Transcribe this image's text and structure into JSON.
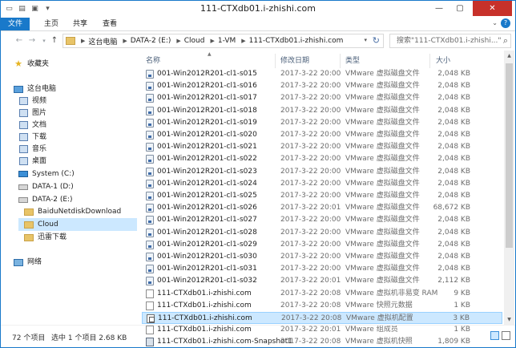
{
  "window": {
    "title": "111-CTXdb01.i-zhishi.com",
    "minimize_glyph": "—",
    "maximize_glyph": "▢",
    "close_glyph": "✕"
  },
  "quick_access": [
    "folder-icon",
    "properties-icon",
    "new-folder-icon",
    "customize-dropdown-icon"
  ],
  "ribbon": {
    "tabs": [
      "文件",
      "主页",
      "共享",
      "查看"
    ],
    "expand_glyph": "⌄",
    "help_glyph": "?"
  },
  "address": {
    "breadcrumbs": [
      "这台电脑",
      "DATA-2 (E:)",
      "Cloud",
      "1-VM",
      "111-CTXdb01.i-zhishi.com"
    ],
    "search_placeholder": "搜索\"111-CTXdb01.i-zhishi...\""
  },
  "nav": {
    "favorites": "收藏夹",
    "this_pc": "这台电脑",
    "videos": "视频",
    "pictures": "图片",
    "documents": "文档",
    "downloads": "下载",
    "music": "音乐",
    "desktop": "桌面",
    "system_c": "System (C:)",
    "data1_d": "DATA-1 (D:)",
    "data2_e": "DATA-2 (E:)",
    "baidu": "BaiduNetdiskDownload",
    "cloud": "Cloud",
    "xunlei": "迅雷下载",
    "network": "网络"
  },
  "columns": {
    "name": "名称",
    "date": "修改日期",
    "type": "类型",
    "size": "大小"
  },
  "files": [
    {
      "name": "001-Win2012R201-cl1-s015",
      "date": "2017-3-22 20:00",
      "type": "VMware 虚拟磁盘文件",
      "size": "2,048 KB",
      "icon": "vmdk"
    },
    {
      "name": "001-Win2012R201-cl1-s016",
      "date": "2017-3-22 20:00",
      "type": "VMware 虚拟磁盘文件",
      "size": "2,048 KB",
      "icon": "vmdk"
    },
    {
      "name": "001-Win2012R201-cl1-s017",
      "date": "2017-3-22 20:00",
      "type": "VMware 虚拟磁盘文件",
      "size": "2,048 KB",
      "icon": "vmdk"
    },
    {
      "name": "001-Win2012R201-cl1-s018",
      "date": "2017-3-22 20:00",
      "type": "VMware 虚拟磁盘文件",
      "size": "2,048 KB",
      "icon": "vmdk"
    },
    {
      "name": "001-Win2012R201-cl1-s019",
      "date": "2017-3-22 20:00",
      "type": "VMware 虚拟磁盘文件",
      "size": "2,048 KB",
      "icon": "vmdk"
    },
    {
      "name": "001-Win2012R201-cl1-s020",
      "date": "2017-3-22 20:00",
      "type": "VMware 虚拟磁盘文件",
      "size": "2,048 KB",
      "icon": "vmdk"
    },
    {
      "name": "001-Win2012R201-cl1-s021",
      "date": "2017-3-22 20:00",
      "type": "VMware 虚拟磁盘文件",
      "size": "2,048 KB",
      "icon": "vmdk"
    },
    {
      "name": "001-Win2012R201-cl1-s022",
      "date": "2017-3-22 20:00",
      "type": "VMware 虚拟磁盘文件",
      "size": "2,048 KB",
      "icon": "vmdk"
    },
    {
      "name": "001-Win2012R201-cl1-s023",
      "date": "2017-3-22 20:00",
      "type": "VMware 虚拟磁盘文件",
      "size": "2,048 KB",
      "icon": "vmdk"
    },
    {
      "name": "001-Win2012R201-cl1-s024",
      "date": "2017-3-22 20:00",
      "type": "VMware 虚拟磁盘文件",
      "size": "2,048 KB",
      "icon": "vmdk"
    },
    {
      "name": "001-Win2012R201-cl1-s025",
      "date": "2017-3-22 20:00",
      "type": "VMware 虚拟磁盘文件",
      "size": "2,048 KB",
      "icon": "vmdk"
    },
    {
      "name": "001-Win2012R201-cl1-s026",
      "date": "2017-3-22 20:01",
      "type": "VMware 虚拟磁盘文件",
      "size": "68,672 KB",
      "icon": "vmdk"
    },
    {
      "name": "001-Win2012R201-cl1-s027",
      "date": "2017-3-22 20:00",
      "type": "VMware 虚拟磁盘文件",
      "size": "2,048 KB",
      "icon": "vmdk"
    },
    {
      "name": "001-Win2012R201-cl1-s028",
      "date": "2017-3-22 20:00",
      "type": "VMware 虚拟磁盘文件",
      "size": "2,048 KB",
      "icon": "vmdk"
    },
    {
      "name": "001-Win2012R201-cl1-s029",
      "date": "2017-3-22 20:00",
      "type": "VMware 虚拟磁盘文件",
      "size": "2,048 KB",
      "icon": "vmdk"
    },
    {
      "name": "001-Win2012R201-cl1-s030",
      "date": "2017-3-22 20:00",
      "type": "VMware 虚拟磁盘文件",
      "size": "2,048 KB",
      "icon": "vmdk"
    },
    {
      "name": "001-Win2012R201-cl1-s031",
      "date": "2017-3-22 20:00",
      "type": "VMware 虚拟磁盘文件",
      "size": "2,048 KB",
      "icon": "vmdk"
    },
    {
      "name": "001-Win2012R201-cl1-s032",
      "date": "2017-3-22 20:01",
      "type": "VMware 虚拟磁盘文件",
      "size": "2,112 KB",
      "icon": "vmdk"
    },
    {
      "name": "111-CTXdb01.i-zhishi.com",
      "date": "2017-3-22 20:08",
      "type": "VMware 虚拟机非易变 RAM",
      "size": "9 KB",
      "icon": "doc"
    },
    {
      "name": "111-CTXdb01.i-zhishi.com",
      "date": "2017-3-22 20:08",
      "type": "VMware 快照元数据",
      "size": "1 KB",
      "icon": "doc"
    },
    {
      "name": "111-CTXdb01.i-zhishi.com",
      "date": "2017-3-22 20:08",
      "type": "VMware 虚拟机配置",
      "size": "3 KB",
      "icon": "vmx",
      "selected": true
    },
    {
      "name": "111-CTXdb01.i-zhishi.com",
      "date": "2017-3-22 20:01",
      "type": "VMware 组成员",
      "size": "1 KB",
      "icon": "doc"
    },
    {
      "name": "111-CTXdb01.i-zhishi.com-Snapshot1",
      "date": "2017-3-22 20:08",
      "type": "VMware 虚拟机快照",
      "size": "1,809 KB",
      "icon": "snap"
    }
  ],
  "status": {
    "count": "72 个项目",
    "selection": "选中 1 个项目 2.68 KB"
  },
  "colors": {
    "accent": "#1979ca",
    "selection": "#cce8ff",
    "close": "#c7312a"
  }
}
